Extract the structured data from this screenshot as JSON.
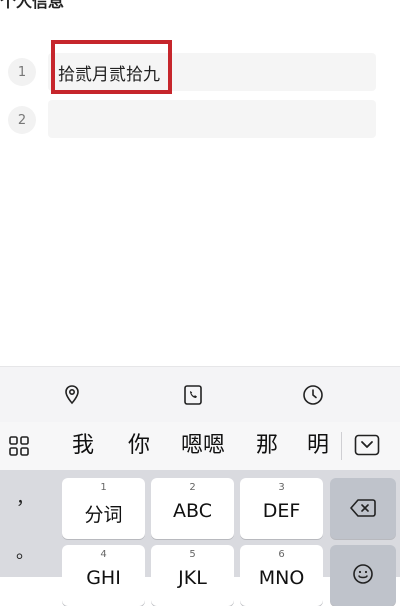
{
  "header": {
    "title": "个人信息"
  },
  "list": {
    "rows": [
      {
        "number": "1",
        "value": "拾贰月贰拾九"
      },
      {
        "number": "2",
        "value": ""
      }
    ]
  },
  "quick_bar": {
    "icons": [
      "location-pin-icon",
      "phone-icon",
      "clock-icon"
    ]
  },
  "candidate_bar": {
    "grid_icon": "grid-icon",
    "candidates": [
      "我",
      "你",
      "嗯嗯",
      "那",
      "明"
    ],
    "collapse_icon": "collapse-keyboard-icon"
  },
  "keyboard": {
    "side_keys": [
      "，",
      "。"
    ],
    "row1": [
      {
        "num": "1",
        "label": "分词"
      },
      {
        "num": "2",
        "label": "ABC"
      },
      {
        "num": "3",
        "label": "DEF"
      }
    ],
    "row2": [
      {
        "num": "4",
        "label": "GHI"
      },
      {
        "num": "5",
        "label": "JKL"
      },
      {
        "num": "6",
        "label": "MNO"
      }
    ],
    "delete_icon": "backspace-icon",
    "emoji_icon": "emoji-icon"
  },
  "colors": {
    "highlight": "#c6262c",
    "keyboard_bg": "#d9dadf"
  }
}
